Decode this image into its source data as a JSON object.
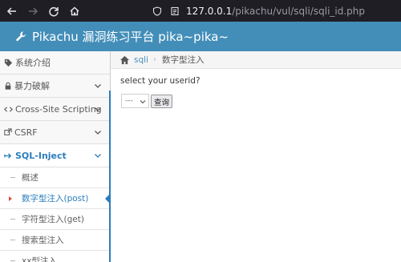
{
  "browser": {
    "url_host": "127.0.0.1",
    "url_path": "/pikachu/vul/sqli/sqli_id.php"
  },
  "app": {
    "title": "Pikachu 漏洞练习平台 pika~pika~"
  },
  "sidebar": {
    "items": [
      {
        "label": "系统介绍",
        "icon": "tag-icon"
      },
      {
        "label": "暴力破解",
        "icon": "lock-icon"
      },
      {
        "label": "Cross-Site Scripting",
        "icon": "code-icon"
      },
      {
        "label": "CSRF",
        "icon": "share-icon"
      },
      {
        "label": "SQL-Inject",
        "icon": "arrow-icon"
      }
    ],
    "subitems": [
      {
        "label": "概述"
      },
      {
        "label": "数字型注入(post)"
      },
      {
        "label": "字符型注入(get)"
      },
      {
        "label": "搜索型注入"
      },
      {
        "label": "xx型注入"
      }
    ]
  },
  "breadcrumb": {
    "link": "sqli",
    "separator": "›",
    "current": "数字型注入"
  },
  "main": {
    "prompt": "select your userid?",
    "select_value": "---",
    "button_label": "查询"
  },
  "colors": {
    "header": "#438eb9",
    "accent": "#2b7dbc",
    "browser_bar": "#1f1e25"
  }
}
